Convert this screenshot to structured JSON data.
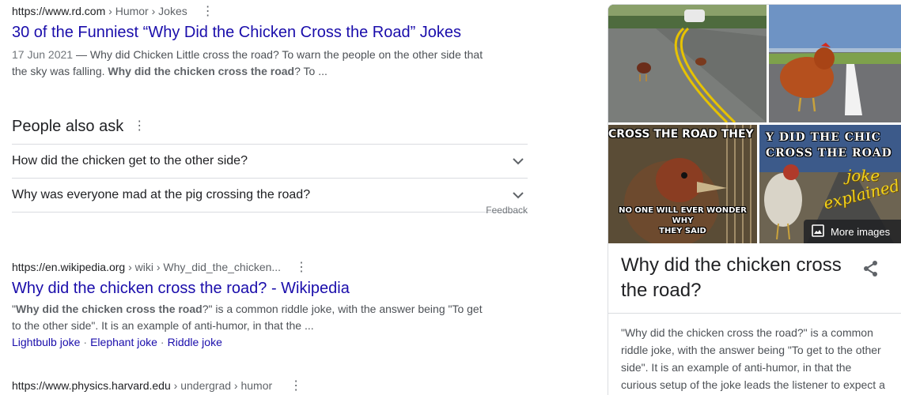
{
  "results": [
    {
      "cite_domain": "https://www.rd.com",
      "cite_path": " › Humor › Jokes",
      "title": "30 of the Funniest “Why Did the Chicken Cross the Road” Jokes",
      "date": "17 Jun 2021",
      "snippet_line1": " — Why did Chicken Little cross the road? To warn the people on the other side that",
      "snippet_line2_pre": "the sky was falling. ",
      "snippet_line2_bold": "Why did the chicken cross the road",
      "snippet_line2_post": "? To ..."
    },
    {
      "cite_domain": "https://en.wikipedia.org",
      "cite_path": " › wiki › Why_did_the_chicken...",
      "title": "Why did the chicken cross the road? - Wikipedia",
      "snippet_pre": "\"",
      "snippet_bold": "Why did the chicken cross the road",
      "snippet_post": "?\" is a common riddle joke, with the answer being \"To get to the other side\". It is an example of anti-humor, in that the ...",
      "sitelinks": [
        "Lightbulb joke",
        "Elephant joke",
        "Riddle joke"
      ]
    },
    {
      "cite_domain": "https://www.physics.harvard.edu",
      "cite_path": " › undergrad › humor"
    }
  ],
  "paa": {
    "heading": "People also ask",
    "questions": [
      "How did the chicken get to the other side?",
      "Why was everyone mad at the pig crossing the road?"
    ],
    "feedback": "Feedback"
  },
  "knowledge_panel": {
    "images": {
      "caption_top_left": "CROSS THE ROAD THEY SAID",
      "caption_bottom_left_1": "NO ONE WILL EVER WONDER WHY",
      "caption_bottom_left_2": "THEY SAID",
      "caption_top_right_1": "Y DID THE CHIC",
      "caption_top_right_2": "CROSS THE ROAD",
      "caption_joke_1": "joke",
      "caption_joke_2": "explained"
    },
    "more_images": "More images",
    "title": "Why did the chicken cross the road?",
    "description": "\"Why did the chicken cross the road?\" is a common riddle joke, with the answer being \"To get to the other side\". It is an example of anti-humor, in that the curious setup of the joke leads the listener to expect a"
  },
  "icons": {
    "menu": "three-dots-vertical-icon",
    "expand": "chevron-down-icon",
    "share": "share-icon",
    "image": "image-icon"
  }
}
